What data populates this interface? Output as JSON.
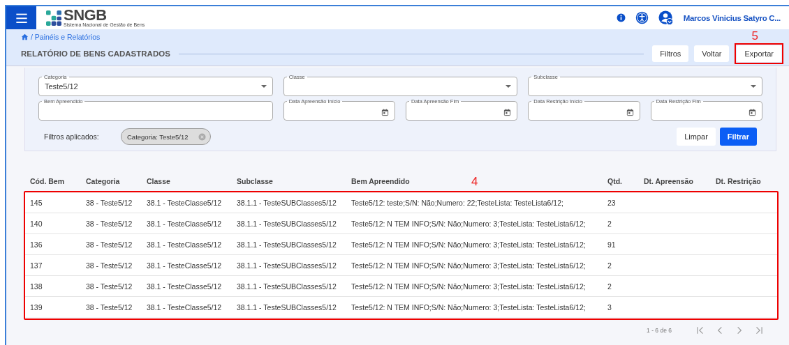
{
  "header": {
    "logo": {
      "title": "SNGB",
      "subtitle": "Sistema Nacional de Gestão de Bens"
    },
    "user_name": "Marcos Vinicius Satyro C..."
  },
  "breadcrumb": {
    "path": "/ Painéis e Relatórios"
  },
  "page_title": "RELATÓRIO DE BENS CADASTRADOS",
  "actions": [
    {
      "label": "Filtros"
    },
    {
      "label": "Voltar"
    },
    {
      "label": "Exportar",
      "annotation": "5"
    }
  ],
  "filters": {
    "fields": [
      {
        "label": "Categoria",
        "kind": "select",
        "value": "Teste5/12"
      },
      {
        "label": "Classe",
        "kind": "select"
      },
      {
        "label": "Subclasse",
        "kind": "select"
      },
      {
        "label": "Bem Apreendido",
        "kind": "text"
      },
      {
        "label": "Data Apreensão Início",
        "kind": "date"
      },
      {
        "label": "Data Apreensão Fim",
        "kind": "date"
      },
      {
        "label": "Data Restrição Início",
        "kind": "date"
      },
      {
        "label": "Data Restrição Fim",
        "kind": "date"
      }
    ],
    "applied_label": "Filtros aplicados:",
    "applied_chips": [
      "Categoria: Teste5/12"
    ],
    "buttons": [
      {
        "label": "Limpar",
        "kind": "secondary"
      },
      {
        "label": "Filtrar",
        "kind": "primary"
      }
    ]
  },
  "table": {
    "annotation": "4",
    "columns": [
      "Cód. Bem",
      "Categoria",
      "Classe",
      "Subclasse",
      "Bem Apreendido",
      "Qtd.",
      "Dt. Apreensão",
      "Dt. Restrição"
    ],
    "rows": [
      [
        "145",
        "38 - Teste5/12",
        "38.1 - TesteClasse5/12",
        "38.1.1 - TesteSUBClasses5/12",
        "Teste5/12: teste;S/N: Não;Numero: 22;TesteLista: TesteLista6/12;",
        "23",
        "",
        ""
      ],
      [
        "140",
        "38 - Teste5/12",
        "38.1 - TesteClasse5/12",
        "38.1.1 - TesteSUBClasses5/12",
        "Teste5/12: N TEM INFO;S/N: Não;Numero: 3;TesteLista: TesteLista6/12;",
        "2",
        "",
        ""
      ],
      [
        "136",
        "38 - Teste5/12",
        "38.1 - TesteClasse5/12",
        "38.1.1 - TesteSUBClasses5/12",
        "Teste5/12: N TEM INFO;S/N: Não;Numero: 3;TesteLista: TesteLista6/12;",
        "91",
        "",
        ""
      ],
      [
        "137",
        "38 - Teste5/12",
        "38.1 - TesteClasse5/12",
        "38.1.1 - TesteSUBClasses5/12",
        "Teste5/12: N TEM INFO;S/N: Não;Numero: 3;TesteLista: TesteLista6/12;",
        "2",
        "",
        ""
      ],
      [
        "138",
        "38 - Teste5/12",
        "38.1 - TesteClasse5/12",
        "38.1.1 - TesteSUBClasses5/12",
        "Teste5/12: N TEM INFO;S/N: Não;Numero: 3;TesteLista: TesteLista6/12;",
        "2",
        "",
        ""
      ],
      [
        "139",
        "38 - Teste5/12",
        "38.1 - TesteClasse5/12",
        "38.1.1 - TesteSUBClasses5/12",
        "Teste5/12: N TEM INFO;S/N: Não;Numero: 3;TesteLista: TesteLista6/12;",
        "3",
        "",
        ""
      ]
    ]
  },
  "pagination": {
    "range": "1 - 6 de 6"
  }
}
